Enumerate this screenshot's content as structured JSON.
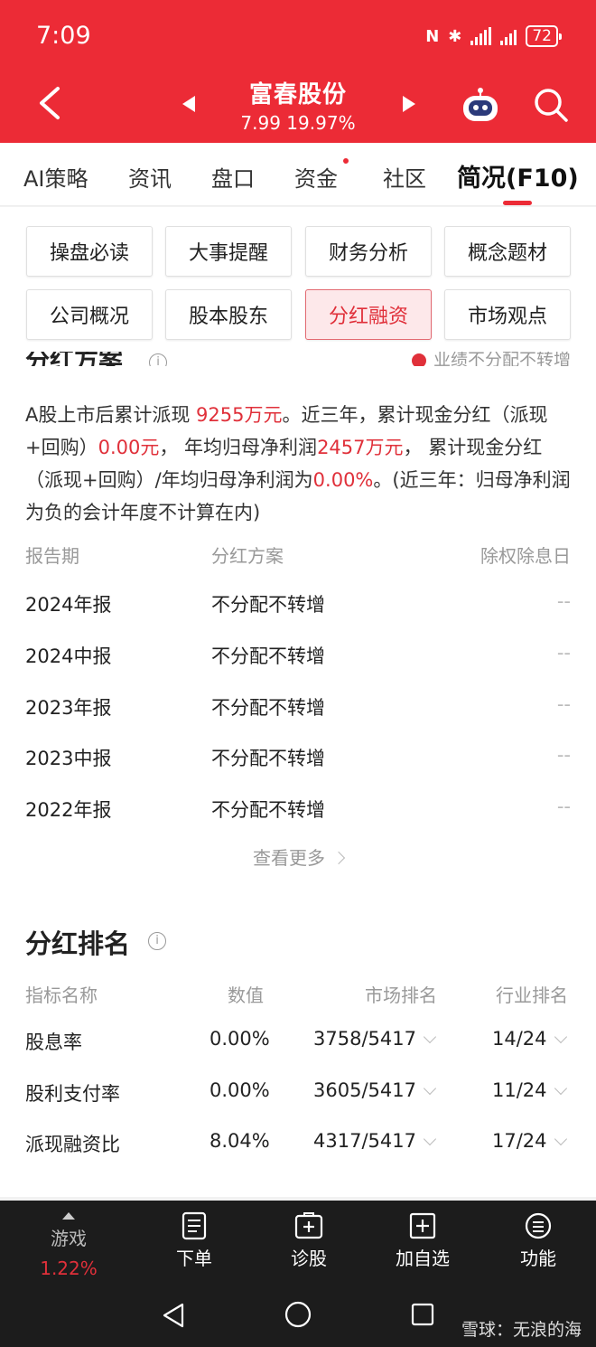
{
  "status": {
    "time": "7:09",
    "battery": "72"
  },
  "header": {
    "stock_name": "富春股份",
    "quote": "7.99  19.97%"
  },
  "tabs": [
    "AI策略",
    "资讯",
    "盘口",
    "资金",
    "社区",
    "简况(F10)"
  ],
  "subtabs": [
    "操盘必读",
    "大事提醒",
    "财务分析",
    "概念题材",
    "公司概况",
    "股本股东",
    "分红融资",
    "市场观点"
  ],
  "dividend": {
    "title": "分红方案",
    "tag": "业绩不分配不转增",
    "summary": {
      "p1": "A股上市后累计派现 ",
      "v1": "9255万元",
      "p2": "。近三年，累计现金分红（派现+回购）",
      "v2": "0.00元",
      "p3": "， 年均归母净利润",
      "v3": "2457万元",
      "p4": "， 累计现金分红（派现+回购）/年均归母净利润为",
      "v4": "0.00%",
      "p5": "。(近三年：归母净利润为负的会计年度不计算在内)"
    },
    "headers": [
      "报告期",
      "分红方案",
      "除权除息日"
    ],
    "rows": [
      {
        "period": "2024年报",
        "plan": "不分配不转增",
        "date": "--"
      },
      {
        "period": "2024中报",
        "plan": "不分配不转增",
        "date": "--"
      },
      {
        "period": "2023年报",
        "plan": "不分配不转增",
        "date": "--"
      },
      {
        "period": "2023中报",
        "plan": "不分配不转增",
        "date": "--"
      },
      {
        "period": "2022年报",
        "plan": "不分配不转增",
        "date": "--"
      }
    ],
    "more": "查看更多"
  },
  "ranking": {
    "title": "分红排名",
    "headers": [
      "指标名称",
      "数值",
      "市场排名",
      "行业排名"
    ],
    "rows": [
      {
        "name": "股息率",
        "value": "0.00%",
        "market": "3758/5417",
        "industry": "14/24"
      },
      {
        "name": "股利支付率",
        "value": "0.00%",
        "market": "3605/5417",
        "industry": "11/24"
      },
      {
        "name": "派现融资比",
        "value": "8.04%",
        "market": "4317/5417",
        "industry": "17/24"
      }
    ]
  },
  "bottom": {
    "game_label": "游戏",
    "game_pct": "1.22%",
    "items": [
      "下单",
      "诊股",
      "加自选",
      "功能"
    ]
  },
  "watermark": "雪球：无浪的海",
  "colors": {
    "brand_red": "#ec2b36",
    "accent_red": "#e0303a"
  }
}
